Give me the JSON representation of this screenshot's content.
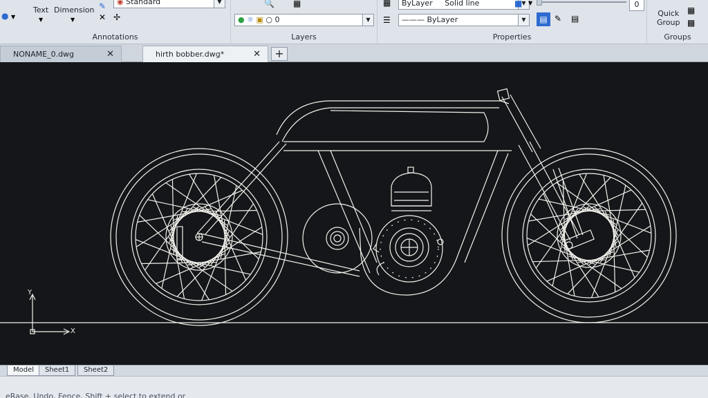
{
  "ribbon": {
    "annotations": {
      "title": "Annotations",
      "text_label": "Text",
      "dimension_label": "Dimension",
      "style_value": "Standard"
    },
    "layers": {
      "title": "Layers",
      "layer_value": "0"
    },
    "properties": {
      "title": "Properties",
      "color_value": "ByLayer",
      "linetype_value": "Solid line",
      "lineweight_value": "ByLayer",
      "transparency_value": "0"
    },
    "groups": {
      "title": "Groups",
      "quick_group_line1": "Quick",
      "quick_group_line2": "Group"
    }
  },
  "tabs": [
    {
      "label": "NONAME_0.dwg",
      "active": false
    },
    {
      "label": "hirth bobber.dwg*",
      "active": true
    }
  ],
  "ucs": {
    "x_label": "X",
    "y_label": "Y"
  },
  "layout_tabs": [
    {
      "label": "Model",
      "active": true
    },
    {
      "label": "Sheet1",
      "active": false
    },
    {
      "label": "Sheet2",
      "active": false
    }
  ],
  "command_line": "eRase, Undo, Fence, Shift + select to extend or",
  "colors": {
    "canvas": "#141619",
    "lines": "#f2f2ec",
    "ribbon": "#dfe4ea"
  }
}
